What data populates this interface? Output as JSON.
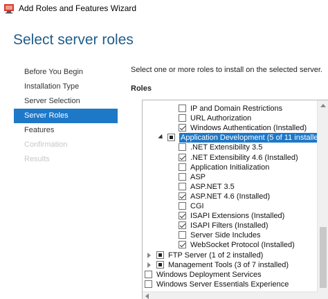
{
  "window": {
    "title": "Add Roles and Features Wizard"
  },
  "page": {
    "title": "Select server roles",
    "instruction": "Select one or more roles to install on the selected server.",
    "roles_label": "Roles"
  },
  "nav": {
    "items": [
      {
        "label": "Before You Begin",
        "state": "normal"
      },
      {
        "label": "Installation Type",
        "state": "normal"
      },
      {
        "label": "Server Selection",
        "state": "normal"
      },
      {
        "label": "Server Roles",
        "state": "active"
      },
      {
        "label": "Features",
        "state": "normal"
      },
      {
        "label": "Confirmation",
        "state": "disabled"
      },
      {
        "label": "Results",
        "state": "disabled"
      }
    ]
  },
  "roles": {
    "rows": [
      {
        "label": "IP and Domain Restrictions",
        "check": "unchecked"
      },
      {
        "label": "URL Authorization",
        "check": "unchecked"
      },
      {
        "label": "Windows Authentication (Installed)",
        "check": "checked"
      },
      {
        "label": "Application Development (5 of 11 installed)",
        "check": "partial",
        "expander": "expanded",
        "selected": true
      },
      {
        "label": ".NET Extensibility 3.5",
        "check": "unchecked"
      },
      {
        "label": ".NET Extensibility 4.6 (Installed)",
        "check": "checked"
      },
      {
        "label": "Application Initialization",
        "check": "unchecked"
      },
      {
        "label": "ASP",
        "check": "unchecked"
      },
      {
        "label": "ASP.NET 3.5",
        "check": "unchecked"
      },
      {
        "label": "ASP.NET 4.6 (Installed)",
        "check": "checked"
      },
      {
        "label": "CGI",
        "check": "unchecked"
      },
      {
        "label": "ISAPI Extensions (Installed)",
        "check": "checked"
      },
      {
        "label": "ISAPI Filters (Installed)",
        "check": "checked"
      },
      {
        "label": "Server Side Includes",
        "check": "unchecked"
      },
      {
        "label": "WebSocket Protocol (Installed)",
        "check": "checked"
      },
      {
        "label": "FTP Server (1 of 2 installed)",
        "check": "partial",
        "expander": "collapsed"
      },
      {
        "label": "Management Tools (3 of 7 installed)",
        "check": "partial",
        "expander": "collapsed"
      },
      {
        "label": "Windows Deployment Services",
        "check": "unchecked"
      },
      {
        "label": "Windows Server Essentials Experience",
        "check": "unchecked"
      }
    ]
  },
  "colors": {
    "accent": "#1e78c8",
    "title_blue": "#1f5d8c"
  }
}
